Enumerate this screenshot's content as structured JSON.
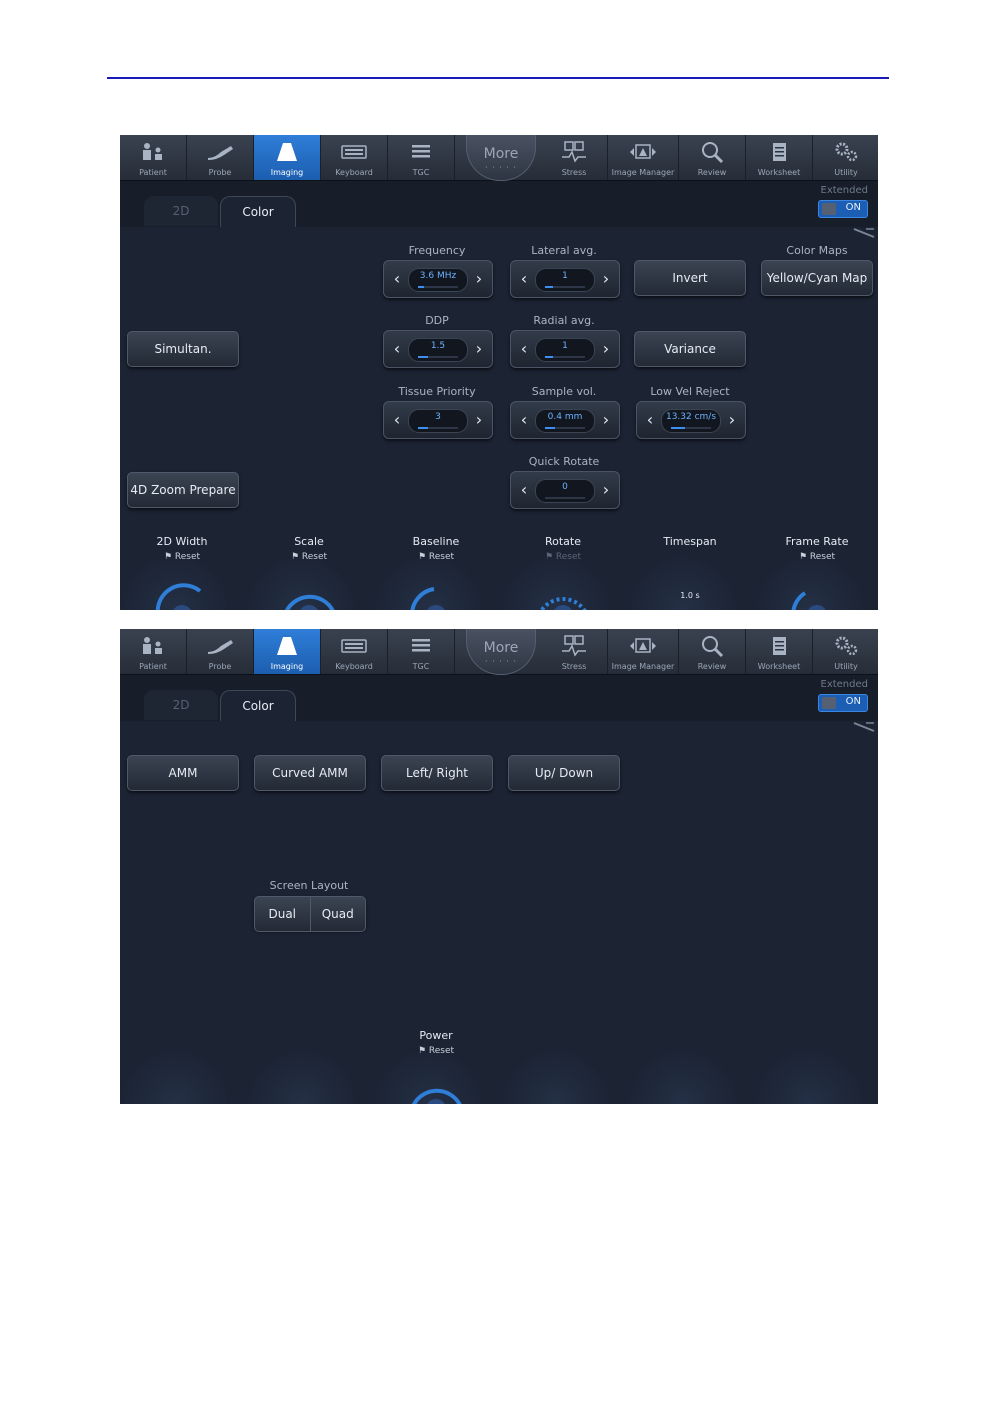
{
  "toolbar": {
    "items": [
      {
        "label": "Patient",
        "icon": "patient-icon"
      },
      {
        "label": "Probe",
        "icon": "probe-icon"
      },
      {
        "label": "Imaging",
        "icon": "imaging-icon"
      },
      {
        "label": "Keyboard",
        "icon": "keyboard-icon"
      },
      {
        "label": "TGC",
        "icon": "tgc-icon"
      },
      {
        "label": "Stress",
        "icon": "stress-icon"
      },
      {
        "label": "Image Manager",
        "icon": "image-manager-icon"
      },
      {
        "label": "Review",
        "icon": "review-icon"
      },
      {
        "label": "Worksheet",
        "icon": "worksheet-icon"
      },
      {
        "label": "Utility",
        "icon": "utility-icon"
      }
    ],
    "more_label": "More",
    "more_dots": "· · · · ·",
    "active": "Imaging"
  },
  "tabs": {
    "tab_2d": "2D",
    "tab_color": "Color",
    "active": "Color"
  },
  "extended": {
    "label": "Extended",
    "state": "ON"
  },
  "screen1": {
    "buttons": {
      "invert": "Invert",
      "yellow_cyan": "Yellow/Cyan Map",
      "variance": "Variance",
      "simultan": "Simultan.",
      "zoom4d": "4D Zoom Prepare"
    },
    "labels": {
      "color_maps": "Color Maps"
    },
    "steppers": {
      "frequency": {
        "label": "Frequency",
        "value": "3.6 MHz",
        "level": 0.15
      },
      "lateral_avg": {
        "label": "Lateral avg.",
        "value": "1",
        "level": 0.2
      },
      "ddp": {
        "label": "DDP",
        "value": "1.5",
        "level": 0.25
      },
      "radial_avg": {
        "label": "Radial avg.",
        "value": "1",
        "level": 0.2
      },
      "tissue_priority": {
        "label": "Tissue Priority",
        "value": "3",
        "level": 0.25
      },
      "sample_vol": {
        "label": "Sample vol.",
        "value": "0.4 mm",
        "level": 0.25
      },
      "low_vel_reject": {
        "label": "Low Vel Reject",
        "value": "13.32 cm/s",
        "level": 0.35
      },
      "quick_rotate": {
        "label": "Quick Rotate",
        "value": "0",
        "level": 0.0
      }
    },
    "knobs": [
      {
        "label": "2D Width",
        "reset": "Reset",
        "dim": false
      },
      {
        "label": "Scale",
        "reset": "Reset",
        "dim": false
      },
      {
        "label": "Baseline",
        "reset": "Reset",
        "dim": false
      },
      {
        "label": "Rotate",
        "reset": "Reset",
        "dim": true
      },
      {
        "label": "Timespan",
        "reset": "",
        "dim": false,
        "value": "1.0 s"
      },
      {
        "label": "Frame Rate",
        "reset": "Reset",
        "dim": false
      }
    ]
  },
  "screen2": {
    "buttons": {
      "amm": "AMM",
      "curved_amm": "Curved AMM",
      "left_right": "Left/ Right",
      "up_down": "Up/ Down"
    },
    "screen_layout": {
      "label": "Screen Layout",
      "dual": "Dual",
      "quad": "Quad"
    },
    "power": {
      "label": "Power",
      "reset": "Reset"
    }
  },
  "colors": {
    "accent": "#2f7ed8",
    "value_blue": "#6ab2ff",
    "panel_bg": "#1c2434"
  }
}
